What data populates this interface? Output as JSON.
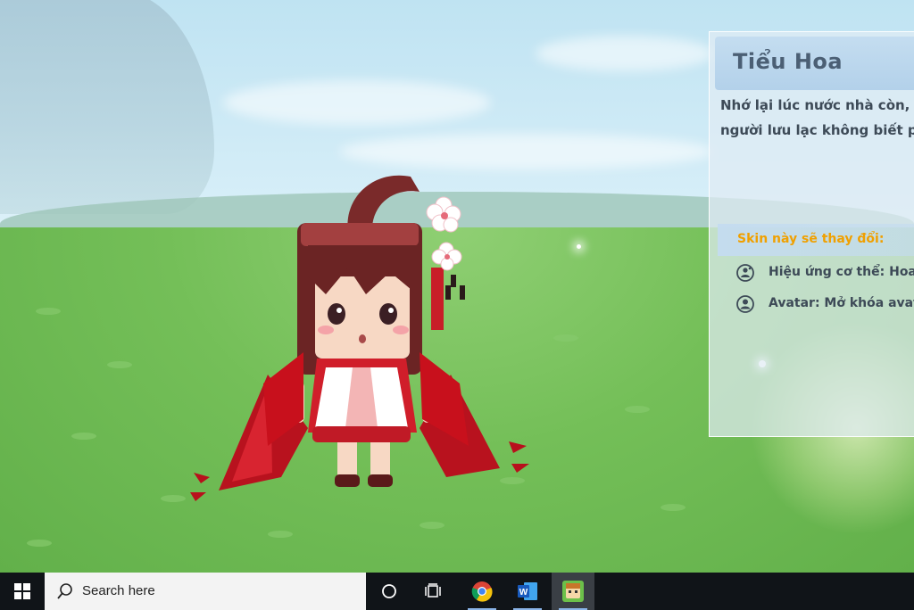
{
  "skin_panel": {
    "title": "Tiểu Hoa",
    "description_lines": [
      "Nhớ lại lúc nước nhà còn, đ",
      "người lưu lạc không biết ph"
    ],
    "changes_header": "Skin này sẽ thay đổi:",
    "changes": [
      {
        "icon": "body-effect-icon",
        "label": "Hiệu ứng cơ thể: Hoa đã"
      },
      {
        "icon": "avatar-icon",
        "label": "Avatar: Mở khóa avatar"
      }
    ],
    "colors": {
      "accent": "#f0a000",
      "text": "#3d4a57",
      "title": "#4b5f74"
    }
  },
  "taskbar": {
    "start_icon": "windows-logo-icon",
    "search_placeholder": "Search here",
    "search_icon": "search-icon",
    "buttons": [
      {
        "name": "cortana-button",
        "icon": "circle-icon"
      },
      {
        "name": "task-view-button",
        "icon": "task-view-icon"
      },
      {
        "name": "chrome-button",
        "icon": "chrome-icon"
      },
      {
        "name": "word-button",
        "icon": "word-icon"
      },
      {
        "name": "game-app-button",
        "icon": "mini-world-icon"
      }
    ]
  }
}
